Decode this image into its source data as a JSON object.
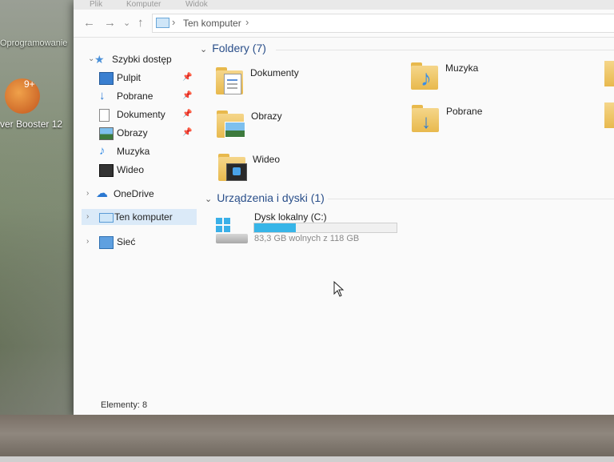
{
  "desktop": {
    "top_label": "Oprogramowanie",
    "app_badge": "9+",
    "app_label": "ver Booster 12"
  },
  "ribbon": {
    "tabs": [
      "Plik",
      "Komputer",
      "Widok"
    ]
  },
  "addressbar": {
    "back": "←",
    "forward": "→",
    "dropdown": "⌄",
    "up": "↑",
    "separator": "›",
    "crumb": "Ten komputer"
  },
  "nav": {
    "quick_access": "Szybki dostęp",
    "pinned": [
      {
        "label": "Pulpit",
        "icon": "desktop-icon",
        "pinned": true
      },
      {
        "label": "Pobrane",
        "icon": "download-icon",
        "pinned": true
      },
      {
        "label": "Dokumenty",
        "icon": "document-icon",
        "pinned": true
      },
      {
        "label": "Obrazy",
        "icon": "pictures-icon",
        "pinned": true
      },
      {
        "label": "Muzyka",
        "icon": "music-icon",
        "pinned": false
      },
      {
        "label": "Wideo",
        "icon": "video-icon",
        "pinned": false
      }
    ],
    "onedrive": "OneDrive",
    "this_pc": "Ten komputer",
    "network": "Sieć"
  },
  "content": {
    "folders_header": "Foldery (7)",
    "folders": [
      {
        "label": "Dokumenty",
        "icon": "documents-folder-icon"
      },
      {
        "label": "Muzyka",
        "icon": "music-folder-icon"
      },
      {
        "label": "Obrazy",
        "icon": "pictures-folder-icon"
      },
      {
        "label": "Pobrane",
        "icon": "downloads-folder-icon"
      },
      {
        "label": "Wideo",
        "icon": "video-folder-icon"
      }
    ],
    "devices_header": "Urządzenia i dyski (1)",
    "drive": {
      "name": "Dysk lokalny (C:)",
      "free_text": "83,3 GB wolnych z 118 GB",
      "used_fraction": 0.294,
      "bar_color": "#37b5e8"
    }
  },
  "status": {
    "items": "Elementy: 8"
  }
}
